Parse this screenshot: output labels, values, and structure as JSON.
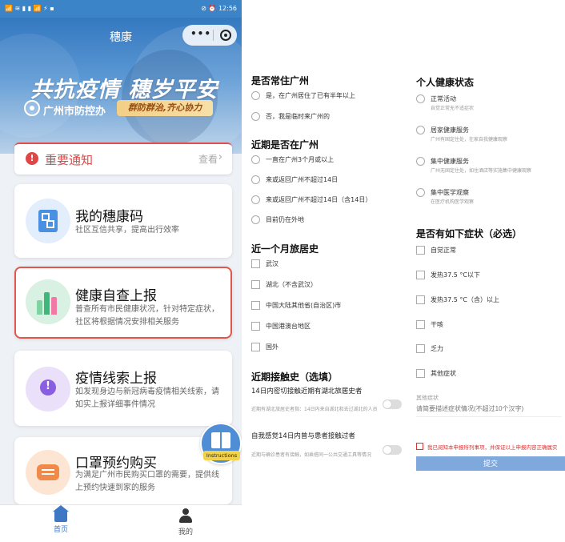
{
  "status_bar": {
    "left": "📶 ≋ ▮ ▮ 📶 ⚡ ▪",
    "right": "⊘ ⏰ 12:56"
  },
  "app": {
    "title": "穗康",
    "capsule_more": "•••"
  },
  "banner": {
    "slogan": "共抗疫情 穗岁平安",
    "org": "广州市防控办",
    "pill": "群防群治,齐心协力"
  },
  "notice": {
    "title": "重要通知",
    "view": "查看",
    "alert_glyph": "!"
  },
  "cards": [
    {
      "title": "我的穗康码",
      "desc": "社区互信共享，提高出行效率",
      "icon": "qr-code-icon"
    },
    {
      "title": "健康自查上报",
      "desc": "普查所有市民健康状况，针对特定症状，社区将根据情况安排相关服务",
      "icon": "health-report-icon"
    },
    {
      "title": "疫情线索上报",
      "desc": "如发现身边与新冠病毒疫情相关线索，请如实上报详细事件情况",
      "icon": "clue-report-icon"
    },
    {
      "title": "口罩预约购买",
      "desc": "为满足广州市民购买口罩的需要，提供线上预约快速到家的服务",
      "icon": "mask-icon"
    }
  ],
  "instructions_label": "Instructions",
  "tabbar": {
    "home": "首页",
    "mine": "我的"
  },
  "form": {
    "resident": {
      "title": "是否常住广州",
      "options": [
        "是，在广州居住了已有半年以上",
        "否，我是临时来广州的"
      ]
    },
    "recent": {
      "title": "近期是否在广州",
      "options": [
        "一直在广州3个月或以上",
        "来或返回广州不超过14日",
        "来或返回广州不超过14日（含14日）",
        "目前仍在外地"
      ]
    },
    "travel": {
      "title": "近一个月旅居史",
      "options": [
        "武汉",
        "湖北（不含武汉）",
        "中国大陆其他省(自治区)市",
        "中国港澳台地区",
        "国外"
      ]
    },
    "contact": {
      "title": "近期接触史（选填）",
      "items": [
        {
          "label": "14日内密切接触近期有湖北旅居史者",
          "sub": "近期有湖北旅居史者指：14日内来自湖北和去过湖北的人员"
        },
        {
          "label": "自我感觉14日内曾与患者接触过者",
          "sub": "近期与确诊患者有接触，如乘搭同一公共交通工具等情况"
        }
      ]
    },
    "health": {
      "title": "个人健康状态",
      "options": [
        {
          "label": "正常活动",
          "sub": "自觉正常无不适症状"
        },
        {
          "label": "居家健康服务",
          "sub": "广州有固定住处，在家自我健康观察"
        },
        {
          "label": "集中健康服务",
          "sub": "广州无固定住处，如住酒店等实施集中健康观察"
        },
        {
          "label": "集中医学观察",
          "sub": "在医疗机构医学观察"
        }
      ]
    },
    "symptoms": {
      "title": "是否有如下症状（必选）",
      "options": [
        "自觉正常",
        "发热37.5 °C以下",
        "发热37.5 °C（含）以上",
        "干咳",
        "乏力",
        "其他症状"
      ]
    },
    "other": {
      "label": "其他症状",
      "placeholder": "请简要描述症状情况(不超过10个汉字)"
    },
    "agreement": "我已阅知本申报所列事项，并保证以上申报内容正确属实",
    "submit": "提交"
  }
}
